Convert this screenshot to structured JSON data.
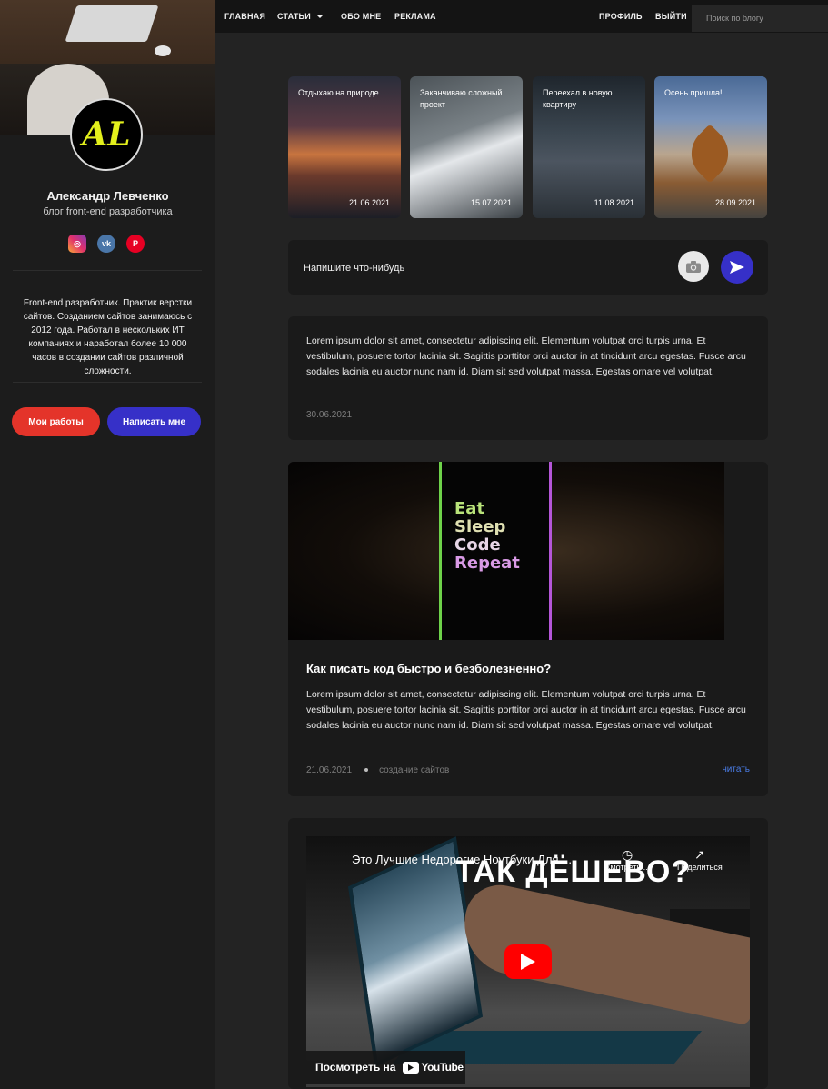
{
  "nav": {
    "home": "ГЛАВНАЯ",
    "articles": "СТАТЬИ",
    "about": "ОБО МНЕ",
    "ads": "РЕКЛАМА",
    "profile": "ПРОФИЛЬ",
    "logout": "ВЫЙТИ",
    "search_placeholder": "Поиск по блогу"
  },
  "sidebar": {
    "avatar_text": "AL",
    "name": "Александр Левченко",
    "subtitle": "блог front-end разработчика",
    "socials": [
      "instagram-icon",
      "vk-icon",
      "pinterest-icon"
    ],
    "about": "Front-end разработчик. Практик верстки сайтов. Созданием сайтов занимаюсь с 2012 года. Работал в нескольких ИТ компаниях и наработал более 10 000 часов в создании сайтов различной сложности.",
    "btn_works": "Мои работы",
    "btn_write": "Написать мне",
    "btn_colors": {
      "works": "#e4342a",
      "write": "#3630c8"
    }
  },
  "stories": [
    {
      "title": "Отдыхаю на природе",
      "date": "21.06.2021"
    },
    {
      "title": "Заканчиваю сложный проект",
      "date": "15.07.2021"
    },
    {
      "title": "Переехал в новую квартиру",
      "date": "11.08.2021"
    },
    {
      "title": "Осень пришла!",
      "date": "28.09.2021"
    }
  ],
  "composer": {
    "placeholder": "Напишите что-нибудь"
  },
  "posts": [
    {
      "text": "Lorem ipsum dolor sit amet, consectetur adipiscing elit. Elementum volutpat orci turpis urna. Et vestibulum, posuere tortor lacinia sit. Sagittis porttitor orci auctor in at tincidunt arcu egestas. Fusce arcu sodales lacinia eu auctor nunc nam id. Diam sit sed volutpat massa. Egestas ornare vel volutpat.",
      "date": "30.06.2021"
    },
    {
      "image_text": [
        "Eat",
        "Sleep",
        "Code",
        "Repeat"
      ],
      "title": "Как писать код быстро и безболезненно?",
      "text": "Lorem ipsum dolor sit amet, consectetur adipiscing elit. Elementum volutpat orci turpis urna. Et vestibulum, posuere tortor lacinia sit. Sagittis porttitor orci auctor in at tincidunt arcu egestas. Fusce arcu sodales lacinia eu auctor nunc nam id. Diam sit sed volutpat massa. Egestas ornare vel volutpat.",
      "date": "21.06.2021",
      "tag": "создание сайтов",
      "read": "читать"
    },
    {
      "video_title": "Это Лучшие Недорогие Ноутбуки Для ...",
      "video_overlay": "ТАК ДЁШЕВО?",
      "watch_later": "Смотреть ...",
      "share": "Поделиться",
      "watch_on": "Посмотреть на",
      "youtube": "YouTube"
    }
  ]
}
